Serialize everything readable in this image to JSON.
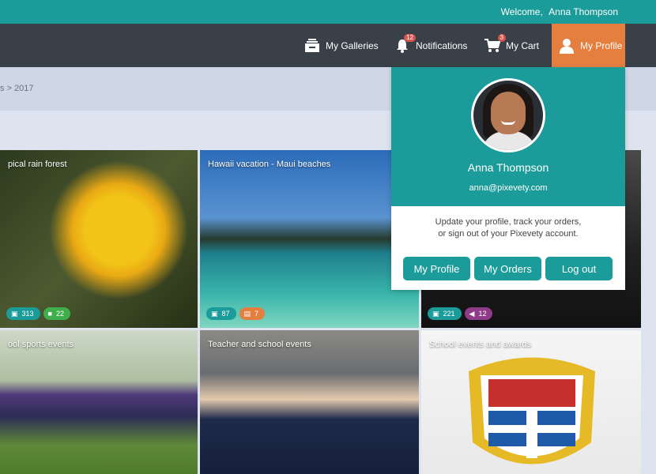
{
  "header": {
    "welcome_prefix": "Welcome,",
    "user_name": "Anna Thompson"
  },
  "nav": {
    "galleries_label": "My Galleries",
    "notifications_label": "Notifications",
    "notifications_count": "12",
    "cart_label": "My Cart",
    "cart_count": "3",
    "profile_label": "My Profile",
    "colors": {
      "topbar": "#1b9c9a",
      "navbar": "#3a4048",
      "profile_active": "#e47f40"
    }
  },
  "breadcrumb": {
    "text": "s > 2017"
  },
  "galleries": [
    {
      "title": "pical rain forest",
      "photos": "313",
      "videos": "22"
    },
    {
      "title": "Hawaii vacation - Maui beaches",
      "photos": "87",
      "documents": "7"
    },
    {
      "title": "",
      "photos": "221",
      "audio": "12"
    },
    {
      "title": "ool sports events"
    },
    {
      "title": "Teacher and school events"
    },
    {
      "title": "School events and awards"
    }
  ],
  "profile_dropdown": {
    "name": "Anna Thompson",
    "email": "anna@pixevety.com",
    "description_line1": "Update your profile, track your orders,",
    "description_line2": "or sign out of your Pixevety account.",
    "buttons": {
      "profile": "My Profile",
      "orders": "My Orders",
      "logout": "Log out"
    }
  }
}
